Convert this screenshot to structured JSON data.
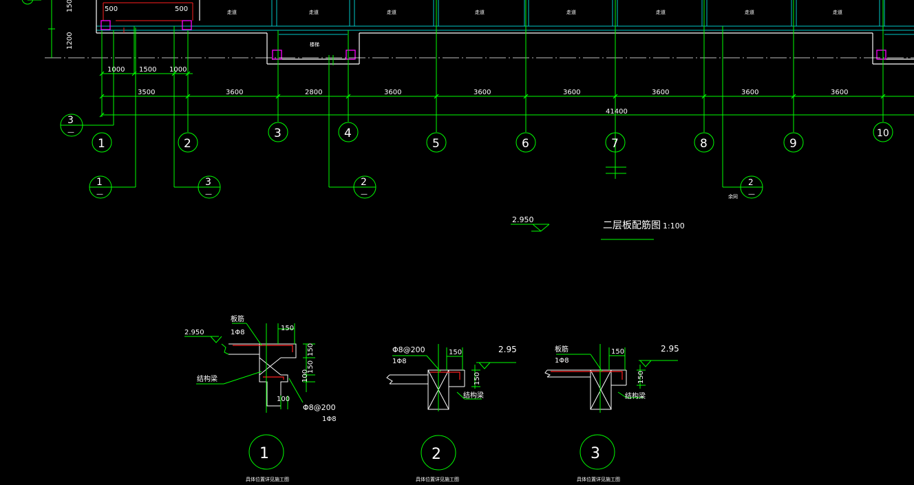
{
  "plan": {
    "left_dims_vertical": [
      "1500",
      "1200"
    ],
    "top_dims": [
      "500",
      "500"
    ],
    "small_dims": [
      "1000",
      "1500",
      "1000"
    ],
    "spans": [
      "3500",
      "3600",
      "2800",
      "3600",
      "3600",
      "3600",
      "3600",
      "3600",
      "3600"
    ],
    "total": "41400",
    "axes": [
      "1",
      "2",
      "3",
      "4",
      "5",
      "6",
      "7",
      "8",
      "9",
      "10"
    ],
    "room_labels": [
      "走道",
      "走道",
      "走道",
      "走道",
      "走道",
      "走道",
      "走道",
      "走道",
      "走道",
      "走道"
    ],
    "room_mid_label": "楼梯",
    "section_refs": [
      {
        "num": "3",
        "sub": "—"
      },
      {
        "num": "1",
        "sub": "—"
      },
      {
        "num": "3",
        "sub": "—"
      },
      {
        "num": "2",
        "sub": "—"
      },
      {
        "num": "2",
        "sub": "—"
      }
    ],
    "yutong_label": "余同",
    "elevation": "2.950",
    "title": "二层板配筋图",
    "scale": "1:100"
  },
  "details": [
    {
      "num": "1",
      "elev": "2.950",
      "slab_label": "板筋",
      "slab_bar": "1Φ8",
      "beam_label": "结构梁",
      "stirrup": "Φ8@200",
      "stirrup_bar": "1Φ8",
      "dim_top": "150",
      "dim_v": [
        "150",
        "150",
        "100"
      ],
      "dim_bot": "100",
      "caption": "具体位置详见施工图"
    },
    {
      "num": "2",
      "elev": "2.95",
      "stirrup": "Φ8@200",
      "slab_bar": "1Φ8",
      "beam_label": "结构梁",
      "dim_top": "150",
      "dim_v": "150",
      "caption": "具体位置详见施工图"
    },
    {
      "num": "3",
      "elev": "2.95",
      "slab_label": "板筋",
      "slab_bar": "1Φ8",
      "beam_label": "结构梁",
      "dim_top": "150",
      "dim_v": "150",
      "caption": "具体位置详见施工图"
    }
  ],
  "colors": {
    "background": "#000000",
    "dim_lines": "#00ff00",
    "walls": "#ffffff",
    "grid_cyan": "#00c8c8",
    "rebar_red": "#ff2020",
    "column_magenta": "#ff00ff"
  }
}
